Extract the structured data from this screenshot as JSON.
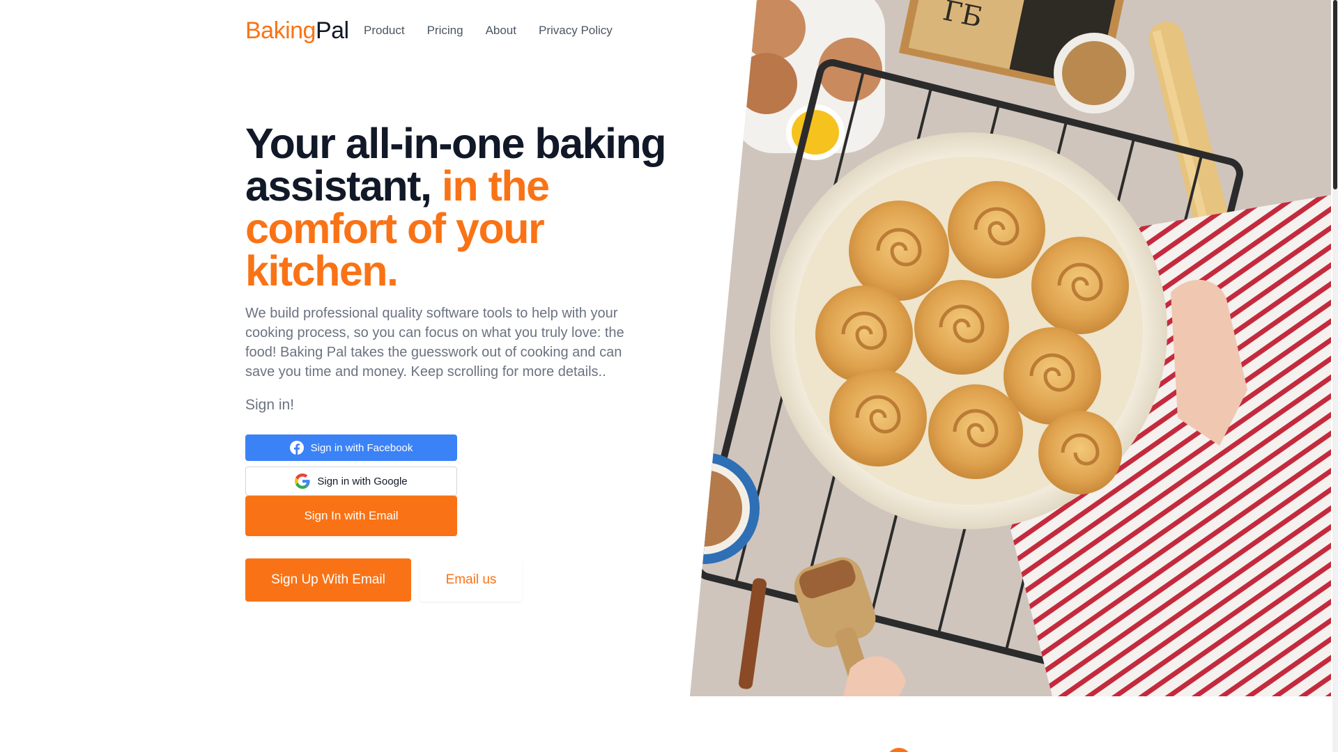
{
  "brand": {
    "name_part1": "Baking",
    "name_part2": "Pal",
    "accent_color": "#f97316",
    "dark_color": "#111827"
  },
  "nav": {
    "items": [
      {
        "label": "Product"
      },
      {
        "label": "Pricing"
      },
      {
        "label": "About"
      },
      {
        "label": "Privacy Policy"
      }
    ]
  },
  "hero": {
    "title_main": "Your all-in-one baking assistant,",
    "title_accent": "in the comfort of your kitchen.",
    "description": "We build professional quality software tools to help with your cooking process, so you can focus on what you truly love: the food! Baking Pal takes the guesswork out of cooking and can save you time and money. Keep scrolling for more details..",
    "signin_label": "Sign in!",
    "image_icon": "cinnamon-rolls-photo"
  },
  "auth": {
    "facebook_label": "Sign in with Facebook",
    "facebook_color": "#3b82f6",
    "facebook_icon": "facebook-icon",
    "google_label": "Sign in with Google",
    "google_icon": "google-icon",
    "email_signin_label": "Sign In with Email",
    "signup_label": "Sign Up With Email",
    "email_us_label": "Email us"
  }
}
